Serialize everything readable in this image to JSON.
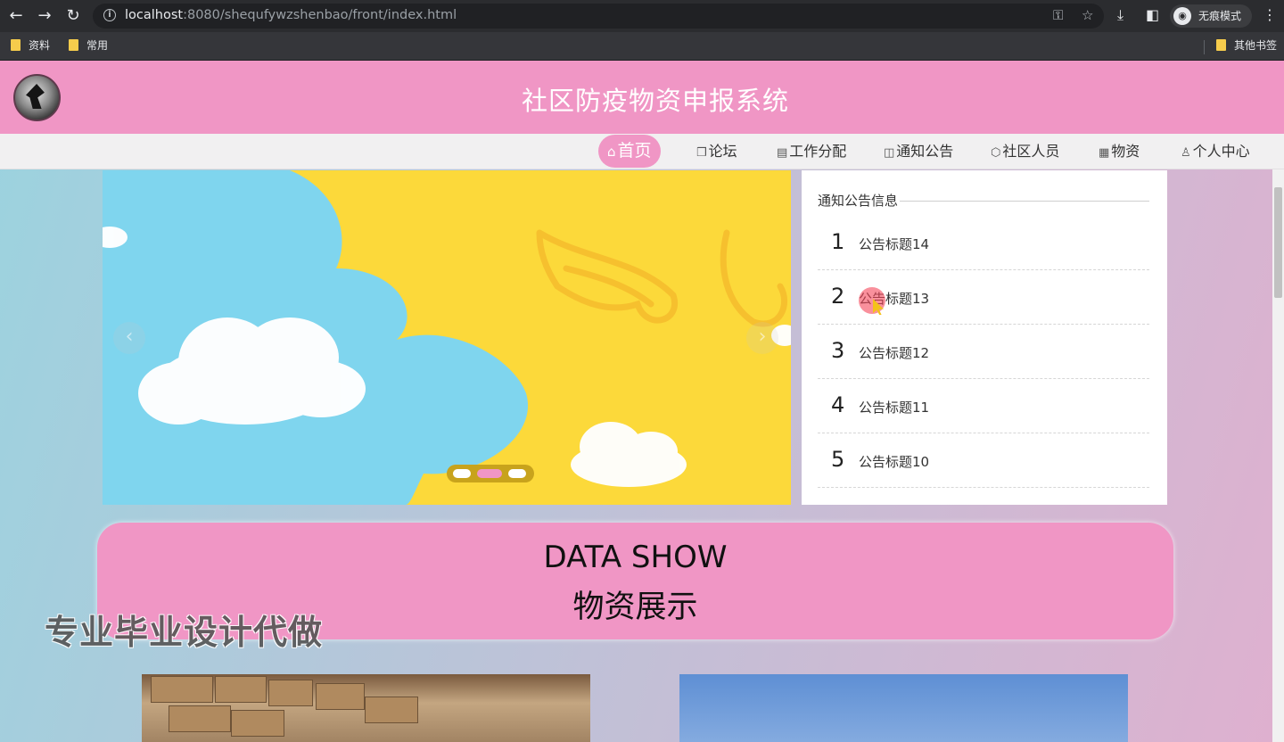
{
  "browser": {
    "url_host": "localhost",
    "url_rest": ":8080/shequfywzshenbao/front/index.html",
    "incognito_label": "无痕模式",
    "bookmarks": [
      "资料",
      "常用"
    ],
    "other_bookmarks": "其他书签",
    "icons": [
      "back-icon",
      "forward-icon",
      "reload-icon",
      "info-icon",
      "key-icon",
      "star-icon",
      "download-icon",
      "sidepanel-icon",
      "incognito-icon",
      "menu-icon"
    ]
  },
  "site": {
    "title": "社区防疫物资申报系统"
  },
  "nav": [
    {
      "icon": "⌂",
      "label": "首页",
      "active": true
    },
    {
      "icon": "❒",
      "label": "论坛"
    },
    {
      "icon": "▤",
      "label": "工作分配"
    },
    {
      "icon": "◫",
      "label": "通知公告"
    },
    {
      "icon": "⬡",
      "label": "社区人员"
    },
    {
      "icon": "▦",
      "label": "物资"
    },
    {
      "icon": "♙",
      "label": "个人中心"
    }
  ],
  "carousel": {
    "prev": "‹",
    "next": "›",
    "slide_count": 3,
    "active_slide": 2
  },
  "notice": {
    "title": "通知公告信息",
    "items": [
      {
        "num": "1",
        "title": "公告标题14"
      },
      {
        "num": "2",
        "title": "公告标题13"
      },
      {
        "num": "3",
        "title": "公告标题12"
      },
      {
        "num": "4",
        "title": "公告标题11"
      },
      {
        "num": "5",
        "title": "公告标题10"
      }
    ]
  },
  "show": {
    "en": "DATA SHOW",
    "cn": "物资展示"
  },
  "watermark": "专业毕业设计代做",
  "colors": {
    "accent": "#f096c5",
    "chrome_dark": "#2b2c2f"
  }
}
